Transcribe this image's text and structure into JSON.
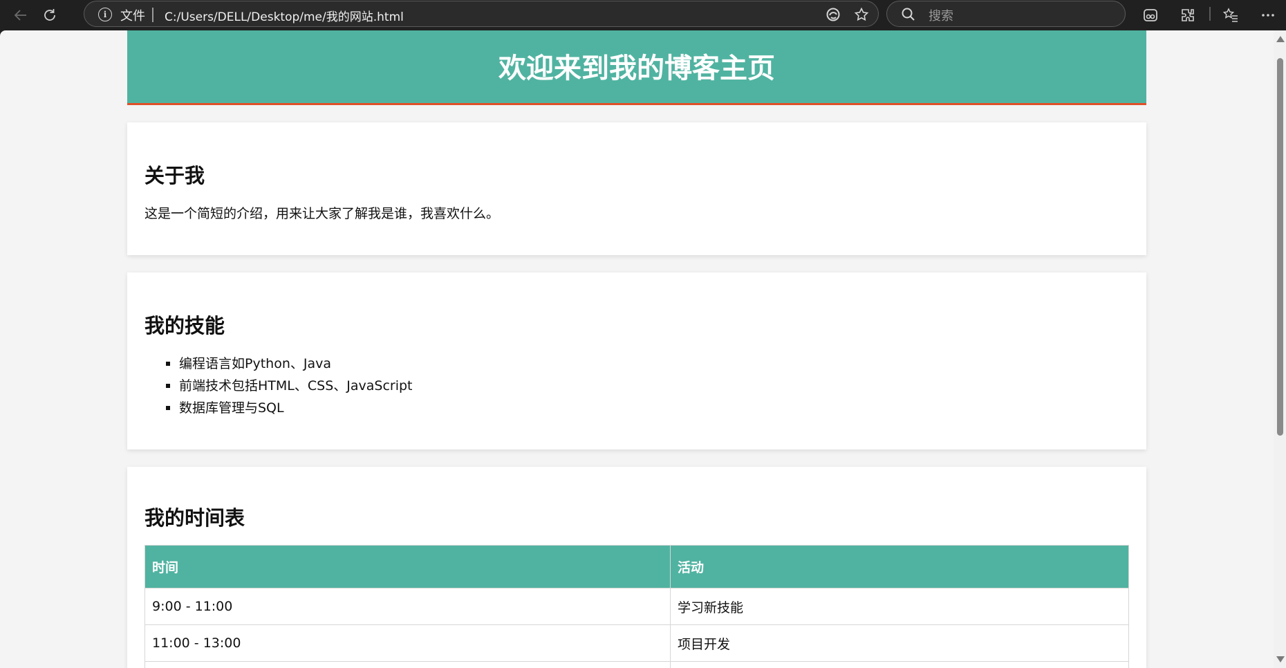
{
  "browser": {
    "address": {
      "scheme_label": "文件",
      "url": "C:/Users/DELL/Desktop/me/我的网站.html"
    },
    "search": {
      "placeholder": "搜索"
    },
    "icons": [
      "back-arrow-icon",
      "refresh-icon",
      "info-icon",
      "read-aloud-icon",
      "favorite-star-icon",
      "search-icon",
      "copilot-icon",
      "extensions-icon",
      "favorites-icon",
      "more-icon"
    ]
  },
  "page": {
    "banner_title": "欢迎来到我的博客主页",
    "about": {
      "heading": "关于我",
      "text": "这是一个简短的介绍，用来让大家了解我是谁，我喜欢什么。"
    },
    "skills": {
      "heading": "我的技能",
      "items": [
        "编程语言如Python、Java",
        "前端技术包括HTML、CSS、JavaScript",
        "数据库管理与SQL"
      ]
    },
    "schedule": {
      "heading": "我的时间表",
      "columns": [
        "时间",
        "活动"
      ],
      "rows": [
        [
          "9:00 - 11:00",
          "学习新技能"
        ],
        [
          "11:00 - 13:00",
          "项目开发"
        ]
      ]
    }
  },
  "colors": {
    "accent": "#50b3a1",
    "banner_border": "#e0502a",
    "page_background": "#f4f4f4",
    "card_background": "#ffffff"
  }
}
